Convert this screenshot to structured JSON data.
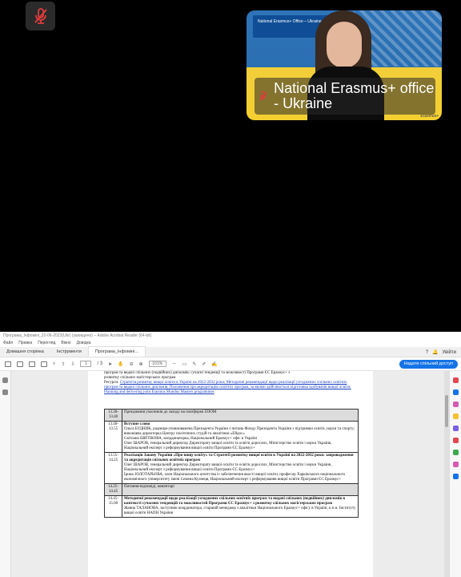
{
  "video": {
    "participant_name": "National Erasmus+ office - Ukraine",
    "banner_text": "National Erasmus+ Office – Ukraine",
    "watermark": "Erasmus+"
  },
  "acrobat": {
    "titlebar": "Програма_Інфоміні_22-06-2023(Ukr) (захищено) – Adobe Acrobat Reader (64-bit)",
    "menu": [
      "Файл",
      "Правка",
      "Перегляд",
      "Вікно",
      "Довідка"
    ],
    "tabs": [
      "Домашня сторінка",
      "Інструменти",
      "Програма_Інфоміні..."
    ],
    "sign_in": "Увійти",
    "page_current": "1",
    "page_total": "/ 3",
    "zoom": "101%",
    "share_button": "Надати спільний доступ"
  },
  "document": {
    "intro_line1": "програм та видачі спільних (подвійних) дипломів: сучасні тенденції та можливості Програми ЄС Еразмус+ з",
    "intro_line2": "розвитку спільних магістерських програм",
    "intro_label": "Ресурси:",
    "intro_link": "Стратегія розвитку вищої освіти в Україні на 2022-2032 роки; Методичні рекомендації щодо реалізації узгоджених спільних освітніх програм та видачі спільних дипломів; Положення про акредитацію освітніх програм, за якими здійснюється підготовка здобувачів вищої освіти; Planning and delivering joint Erasmus Mundus Masters programmes",
    "rows": [
      {
        "time": "13.30-13.40",
        "shade": true,
        "lines": [
          "Приєднання учасників до заходу на платформі ZOOM"
        ]
      },
      {
        "time": "13.40-13.55",
        "shade": false,
        "lines": [
          "Вступне слово",
          "Ольга БУДНИК, радниця-уповноважена Президента України з питань Фонду Президента України з підтримки освіти, науки та спорту; виконавча директорка Центру політичних студій та аналітики «Ейдос»",
          "Світлана ШИТІКОВА, координаторка, Національний Еразмус+ офіс в Україні",
          "Олег ШАРОВ, генеральний директор Директорату вищої освіти та освіти дорослих, Міністерство освіти і науки України, Національний експерт з реформування вищої освіти Програми ЄС Еразмус+"
        ]
      },
      {
        "time": "13.55-14.25",
        "shade": false,
        "lines": [
          "Реалізація Закону України «Про вищу освіту» та Стратегії розвитку вищої освіти в Україні на 2022-2032 роки: запровадження та акредитація спільних освітніх програм",
          "Олег ШАРОВ, генеральний директор Директорату вищої освіти та освіти дорослих, Міністерство освіти і науки України, Національний експерт з реформування вищої освіти Програми ЄС Еразмус+",
          "Ірина ЗОЛОТАРЬОВА, член Національного агентства із забезпечення якості вищої освіти, професор Харківського національного економічного університету імені Семена Кузнеця, Національний експерт з реформування вищої освіти Програми ЄС Еразмус+"
        ]
      },
      {
        "time": "14.25-14.45",
        "shade": true,
        "lines": [
          "Питання-відповіді, коментарі"
        ]
      },
      {
        "time": "14.45-15.00",
        "shade": false,
        "lines": [
          "Методичні рекомендації щодо реалізації узгоджених спільних освітніх програм та видачі спільних (подвійних) дипломів в контексті сучасних тенденцій та можливостей Програми ЄС Еразмус+ з розвитку спільних магістерських програм",
          "Жанна ТАЛАНОВА, заступник координатора, старший менеджер з аналітики Національного Еразмус+ офісу в Україні, к.п.н. Інституту вищої освіти НАПН України"
        ]
      }
    ]
  },
  "colors": {
    "share": "#1473e6",
    "flag_blue": "#2f74b8",
    "flag_yellow": "#f4cf30"
  }
}
